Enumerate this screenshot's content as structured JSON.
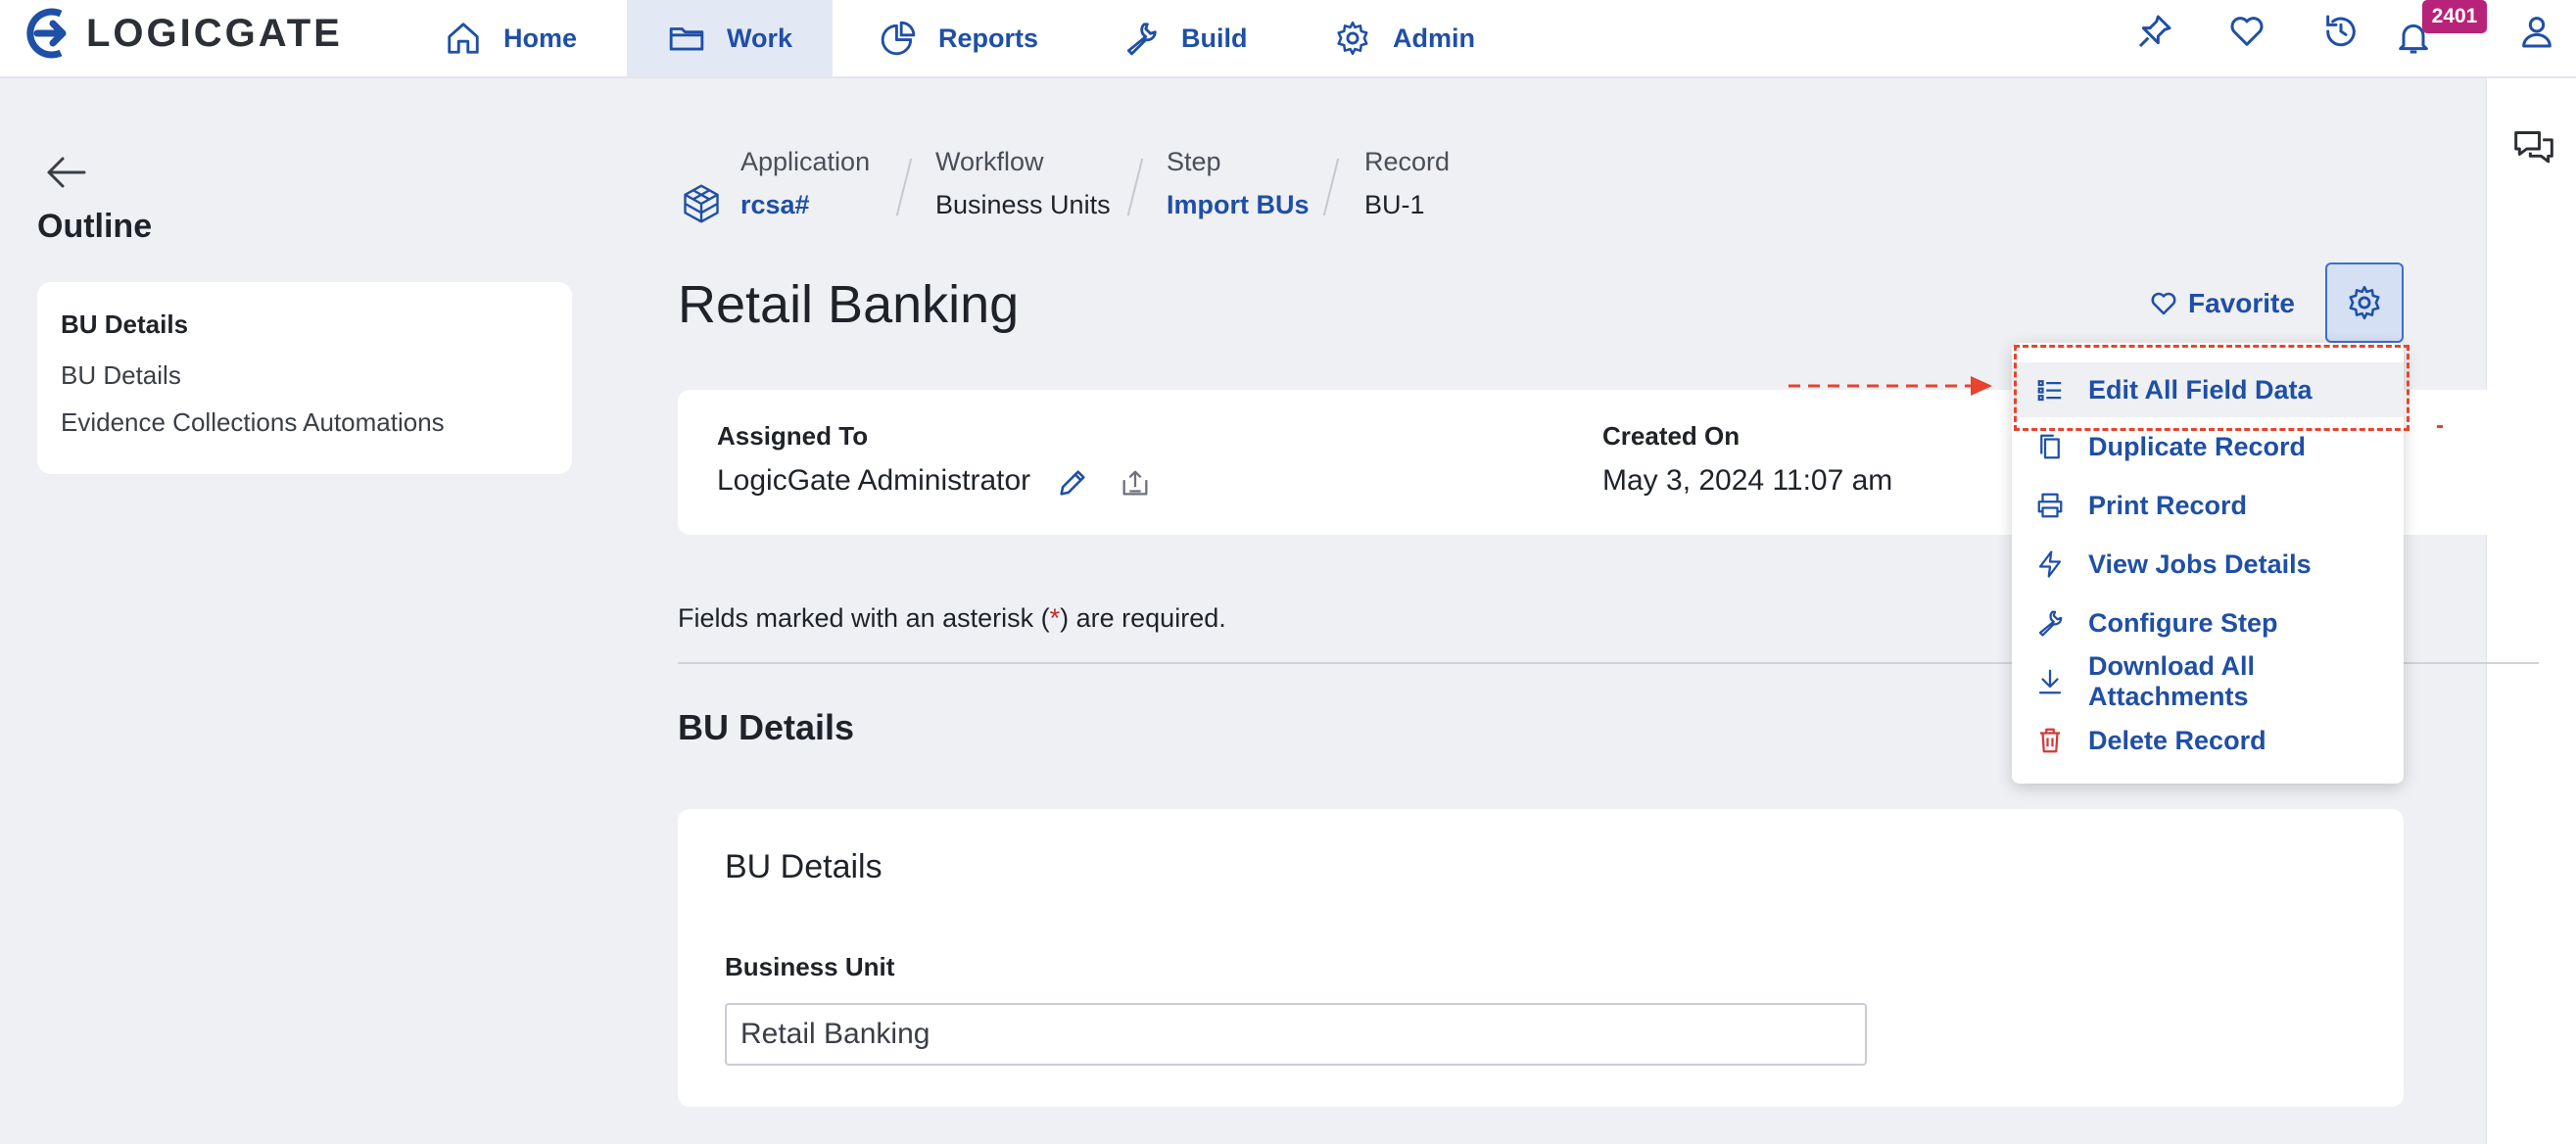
{
  "app": {
    "logo_text": "LOGICGATE",
    "brand_color": "#1f4fa6",
    "badge_color": "#b8237a",
    "annotation_color": "#e8432e"
  },
  "nav": {
    "items": [
      {
        "label": "Home",
        "icon": "home-icon"
      },
      {
        "label": "Work",
        "icon": "folder-icon",
        "active": true
      },
      {
        "label": "Reports",
        "icon": "pie-chart-icon"
      },
      {
        "label": "Build",
        "icon": "wrench-icon"
      },
      {
        "label": "Admin",
        "icon": "gear-icon"
      }
    ],
    "notification_count": "2401",
    "right_icons": [
      "pin-icon",
      "heart-icon",
      "history-icon",
      "bell-icon",
      "user-icon"
    ]
  },
  "outline": {
    "title": "Outline",
    "section_heading": "BU Details",
    "links": [
      "BU Details",
      "Evidence Collections Automations"
    ]
  },
  "breadcrumb": [
    {
      "label": "Application",
      "value": "rcsa#",
      "link": true
    },
    {
      "label": "Workflow",
      "value": "Business Units",
      "link": false
    },
    {
      "label": "Step",
      "value": "Import BUs",
      "link": true
    },
    {
      "label": "Record",
      "value": "BU-1",
      "link": false
    }
  ],
  "record": {
    "title": "Retail Banking",
    "favorite_label": "Favorite",
    "assigned_to_label": "Assigned To",
    "assigned_to_value": "LogicGate Administrator",
    "created_on_label": "Created On",
    "created_on_value": "May 3, 2024 11:07 am",
    "required_note_before": "Fields marked with an asterisk (",
    "required_note_asterisk": "*",
    "required_note_after": ") are required."
  },
  "section": {
    "title": "BU Details",
    "card_title": "BU Details",
    "field_label": "Business Unit",
    "field_value": "Retail Banking"
  },
  "menu": {
    "items": [
      {
        "label": "Edit All Field Data",
        "icon": "list-icon"
      },
      {
        "label": "Duplicate Record",
        "icon": "copy-icon"
      },
      {
        "label": "Print Record",
        "icon": "printer-icon"
      },
      {
        "label": "View Jobs Details",
        "icon": "lightning-icon"
      },
      {
        "label": "Configure Step",
        "icon": "wrench-icon"
      },
      {
        "label": "Download All Attachments",
        "icon": "download-icon"
      },
      {
        "label": "Delete Record",
        "icon": "trash-icon"
      }
    ]
  }
}
